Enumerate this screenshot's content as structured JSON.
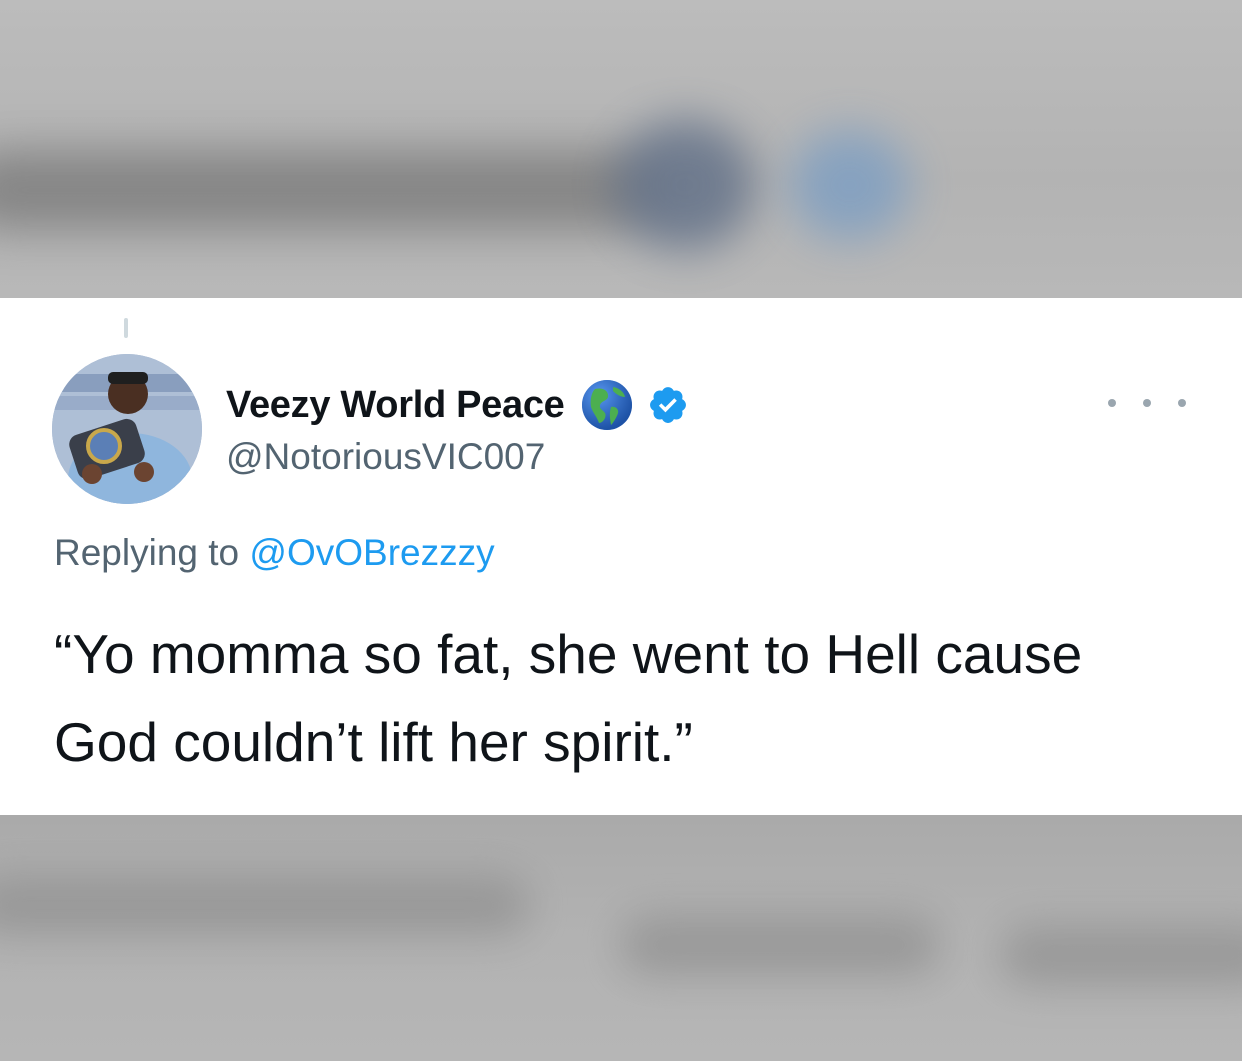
{
  "tweet": {
    "display_name": "Veezy World Peace",
    "name_emoji": "🌎",
    "verified": true,
    "handle": "@NotoriousVIC007",
    "replying_prefix": "Replying to ",
    "replying_to": "@OvOBrezzzy",
    "text": "“Yo momma so fat, she went to Hell cause God couldn’t lift her spirit.”",
    "more_icon": "more-horizontal-icon"
  },
  "colors": {
    "card_bg": "#ffffff",
    "primary_text": "#0f1419",
    "secondary_text": "#536471",
    "link": "#1d9bf0",
    "background_blur": "#b4b4b4"
  }
}
